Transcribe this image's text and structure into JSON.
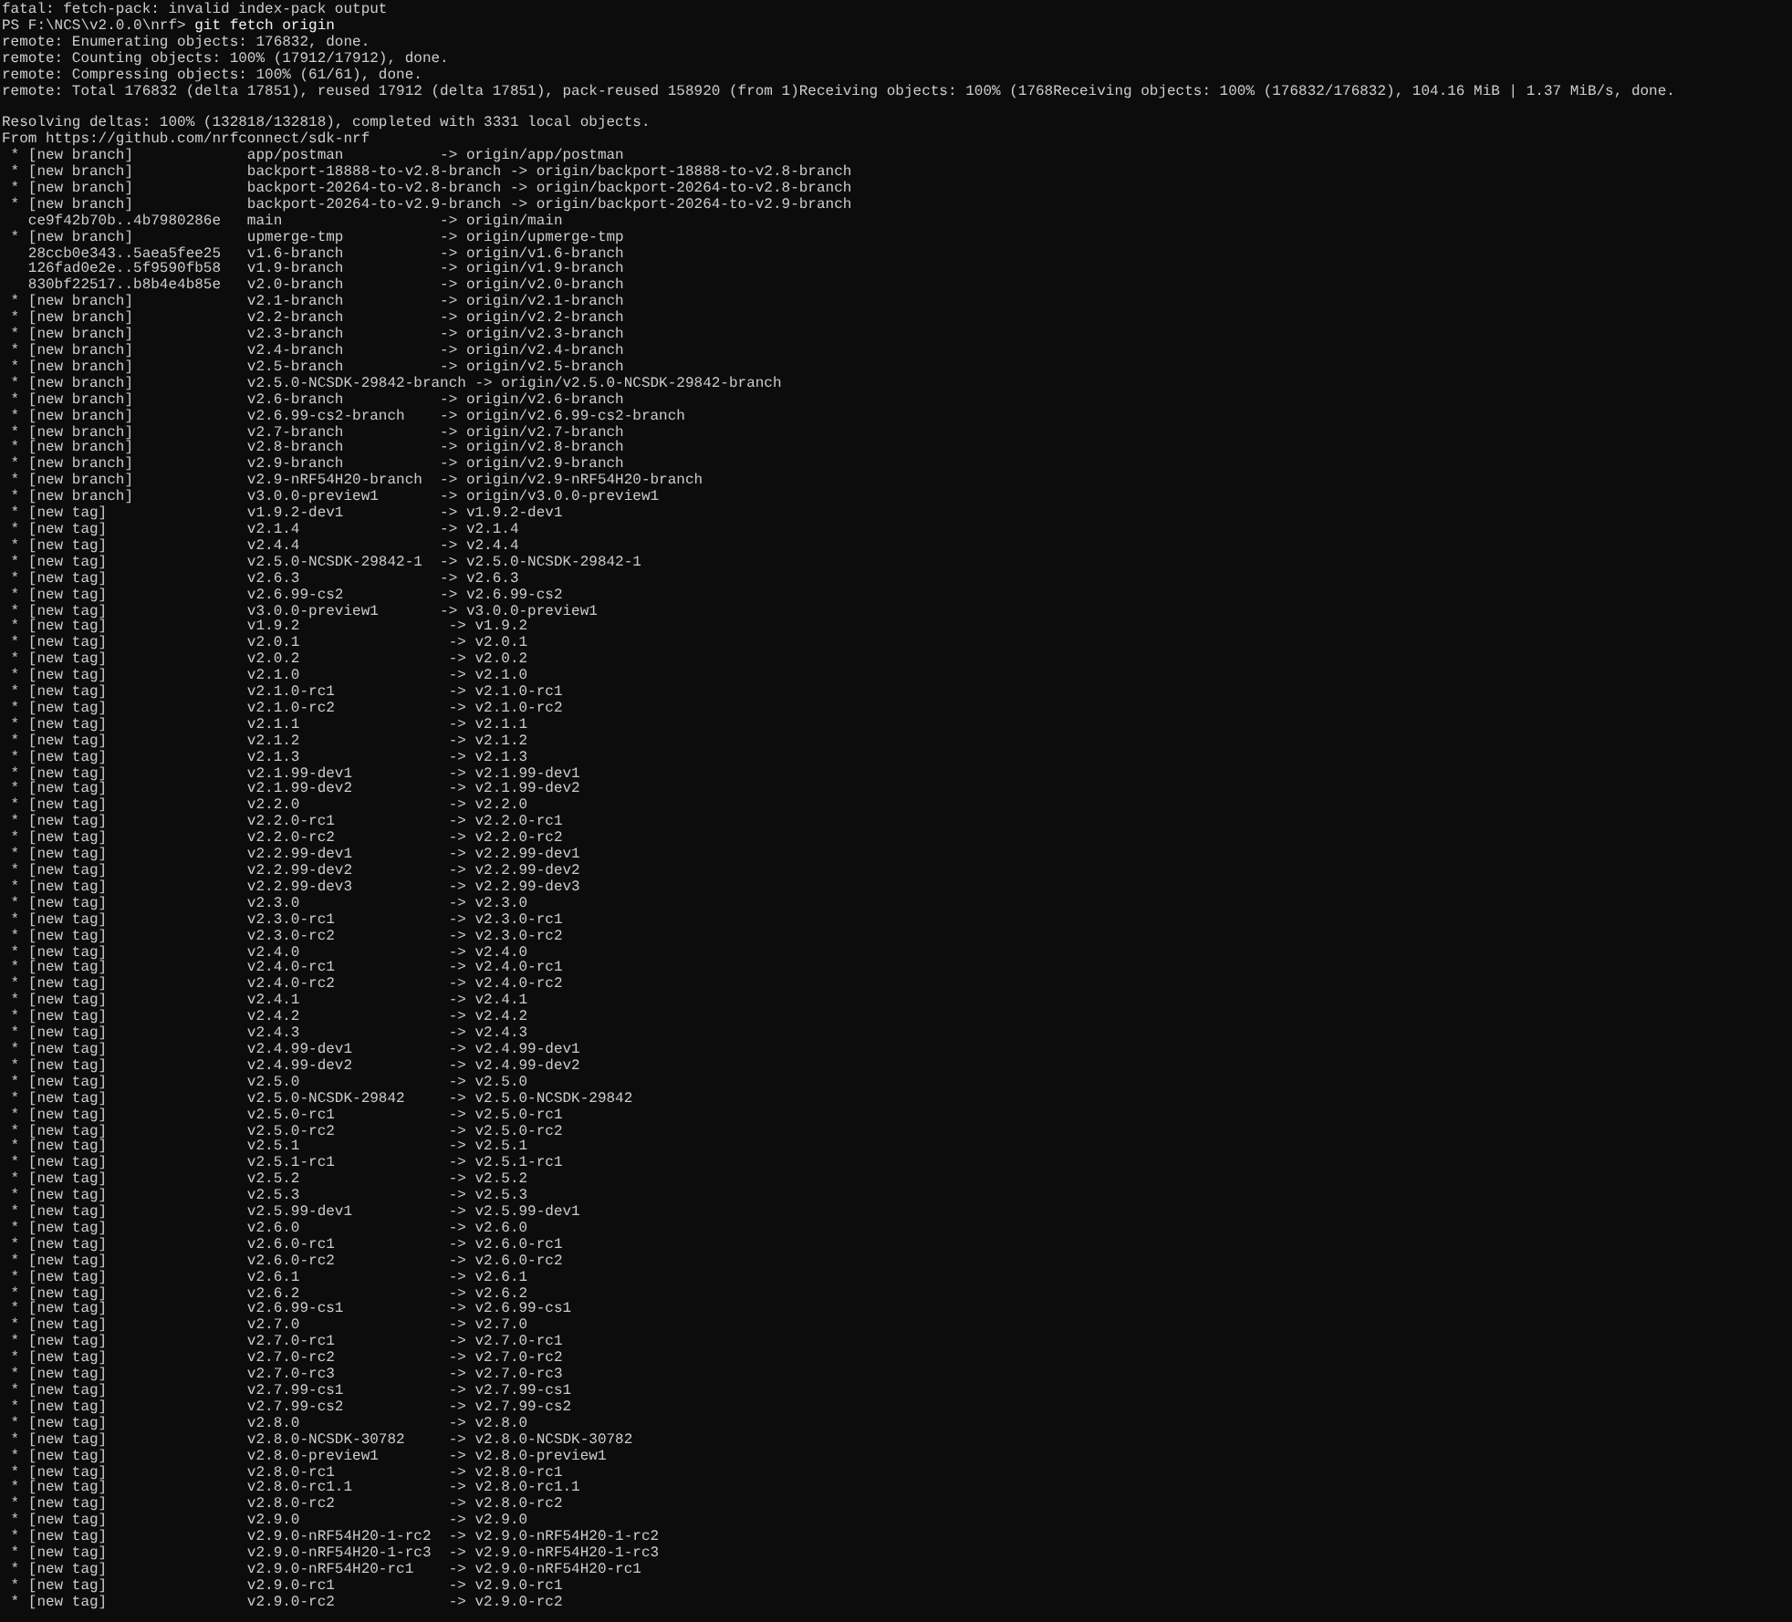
{
  "pre_lines": [
    "fatal: fetch-pack: invalid index-pack output"
  ],
  "prompt": {
    "path": "PS F:\\NCS\\v2.0.0\\nrf>",
    "command": "git fetch origin"
  },
  "output_blocks": [
    [
      "remote: Enumerating objects: 176832, done.",
      "remote: Counting objects: 100% (17912/17912), done.",
      "remote: Compressing objects: 100% (61/61), done.",
      "remote: Total 176832 (delta 17851), reused 17912 (delta 17851), pack-reused 158920 (from 1)Receiving objects: 100% (1768Receiving objects: 100% (176832/176832), 104.16 MiB | 1.37 MiB/s, done."
    ],
    [
      "Resolving deltas: 100% (132818/132818), completed with 3331 local objects.",
      "From https://github.com/nrfconnect/sdk-nrf"
    ]
  ],
  "ref_groups": [
    {
      "refs": [
        {
          "flag": "*",
          "summary": "[new branch]",
          "from": "app/postman",
          "arrow": "->",
          "to": "origin/app/postman"
        },
        {
          "flag": "*",
          "summary": "[new branch]",
          "from": "backport-18888-to-v2.8-branch",
          "arrow": "->",
          "to": "origin/backport-18888-to-v2.8-branch"
        },
        {
          "flag": "*",
          "summary": "[new branch]",
          "from": "backport-20264-to-v2.8-branch",
          "arrow": "->",
          "to": "origin/backport-20264-to-v2.8-branch"
        },
        {
          "flag": "*",
          "summary": "[new branch]",
          "from": "backport-20264-to-v2.9-branch",
          "arrow": "->",
          "to": "origin/backport-20264-to-v2.9-branch"
        },
        {
          "summary": "ce9f42b70b..4b7980286e",
          "from": "main",
          "arrow": "->",
          "to": "origin/main"
        },
        {
          "flag": "*",
          "summary": "[new branch]",
          "from": "upmerge-tmp",
          "arrow": "->",
          "to": "origin/upmerge-tmp"
        },
        {
          "summary": "28ccb0e343..5aea5fee25",
          "from": "v1.6-branch",
          "arrow": "->",
          "to": "origin/v1.6-branch"
        },
        {
          "summary": "126fad0e2e..5f9590fb58",
          "from": "v1.9-branch",
          "arrow": "->",
          "to": "origin/v1.9-branch"
        },
        {
          "summary": "830bf22517..b8b4e4b85e",
          "from": "v2.0-branch",
          "arrow": "->",
          "to": "origin/v2.0-branch"
        },
        {
          "flag": "*",
          "summary": "[new branch]",
          "from": "v2.1-branch",
          "arrow": "->",
          "to": "origin/v2.1-branch"
        },
        {
          "flag": "*",
          "summary": "[new branch]",
          "from": "v2.2-branch",
          "arrow": "->",
          "to": "origin/v2.2-branch"
        },
        {
          "flag": "*",
          "summary": "[new branch]",
          "from": "v2.3-branch",
          "arrow": "->",
          "to": "origin/v2.3-branch"
        },
        {
          "flag": "*",
          "summary": "[new branch]",
          "from": "v2.4-branch",
          "arrow": "->",
          "to": "origin/v2.4-branch"
        },
        {
          "flag": "*",
          "summary": "[new branch]",
          "from": "v2.5-branch",
          "arrow": "->",
          "to": "origin/v2.5-branch"
        },
        {
          "flag": "*",
          "summary": "[new branch]",
          "from": "v2.5.0-NCSDK-29842-branch",
          "arrow": "->",
          "to": "origin/v2.5.0-NCSDK-29842-branch"
        },
        {
          "flag": "*",
          "summary": "[new branch]",
          "from": "v2.6-branch",
          "arrow": "->",
          "to": "origin/v2.6-branch"
        },
        {
          "flag": "*",
          "summary": "[new branch]",
          "from": "v2.6.99-cs2-branch",
          "arrow": "->",
          "to": "origin/v2.6.99-cs2-branch"
        },
        {
          "flag": "*",
          "summary": "[new branch]",
          "from": "v2.7-branch",
          "arrow": "->",
          "to": "origin/v2.7-branch"
        },
        {
          "flag": "*",
          "summary": "[new branch]",
          "from": "v2.8-branch",
          "arrow": "->",
          "to": "origin/v2.8-branch"
        },
        {
          "flag": "*",
          "summary": "[new branch]",
          "from": "v2.9-branch",
          "arrow": "->",
          "to": "origin/v2.9-branch"
        },
        {
          "flag": "*",
          "summary": "[new branch]",
          "from": "v2.9-nRF54H20-branch",
          "arrow": "->",
          "to": "origin/v2.9-nRF54H20-branch"
        },
        {
          "flag": "*",
          "summary": "[new branch]",
          "from": "v3.0.0-preview1",
          "arrow": "->",
          "to": "origin/v3.0.0-preview1"
        },
        {
          "flag": "*",
          "summary": "[new tag]",
          "from": "v1.9.2-dev1",
          "arrow": "->",
          "to": "v1.9.2-dev1"
        },
        {
          "flag": "*",
          "summary": "[new tag]",
          "from": "v2.1.4",
          "arrow": "->",
          "to": "v2.1.4"
        },
        {
          "flag": "*",
          "summary": "[new tag]",
          "from": "v2.4.4",
          "arrow": "->",
          "to": "v2.4.4"
        },
        {
          "flag": "*",
          "summary": "[new tag]",
          "from": "v2.5.0-NCSDK-29842-1",
          "arrow": "->",
          "to": "v2.5.0-NCSDK-29842-1"
        },
        {
          "flag": "*",
          "summary": "[new tag]",
          "from": "v2.6.3",
          "arrow": "->",
          "to": "v2.6.3"
        },
        {
          "flag": "*",
          "summary": "[new tag]",
          "from": "v2.6.99-cs2",
          "arrow": "->",
          "to": "v2.6.99-cs2"
        },
        {
          "flag": "*",
          "summary": "[new tag]",
          "from": "v3.0.0-preview1",
          "arrow": "->",
          "to": "v3.0.0-preview1"
        }
      ]
    },
    {
      "refs": [
        {
          "flag": "*",
          "summary": "[new tag]",
          "from": "v1.9.2",
          "arrow": "->",
          "to": "v1.9.2"
        },
        {
          "flag": "*",
          "summary": "[new tag]",
          "from": "v2.0.1",
          "arrow": "->",
          "to": "v2.0.1"
        },
        {
          "flag": "*",
          "summary": "[new tag]",
          "from": "v2.0.2",
          "arrow": "->",
          "to": "v2.0.2"
        },
        {
          "flag": "*",
          "summary": "[new tag]",
          "from": "v2.1.0",
          "arrow": "->",
          "to": "v2.1.0"
        },
        {
          "flag": "*",
          "summary": "[new tag]",
          "from": "v2.1.0-rc1",
          "arrow": "->",
          "to": "v2.1.0-rc1"
        },
        {
          "flag": "*",
          "summary": "[new tag]",
          "from": "v2.1.0-rc2",
          "arrow": "->",
          "to": "v2.1.0-rc2"
        },
        {
          "flag": "*",
          "summary": "[new tag]",
          "from": "v2.1.1",
          "arrow": "->",
          "to": "v2.1.1"
        },
        {
          "flag": "*",
          "summary": "[new tag]",
          "from": "v2.1.2",
          "arrow": "->",
          "to": "v2.1.2"
        },
        {
          "flag": "*",
          "summary": "[new tag]",
          "from": "v2.1.3",
          "arrow": "->",
          "to": "v2.1.3"
        },
        {
          "flag": "*",
          "summary": "[new tag]",
          "from": "v2.1.99-dev1",
          "arrow": "->",
          "to": "v2.1.99-dev1"
        },
        {
          "flag": "*",
          "summary": "[new tag]",
          "from": "v2.1.99-dev2",
          "arrow": "->",
          "to": "v2.1.99-dev2"
        },
        {
          "flag": "*",
          "summary": "[new tag]",
          "from": "v2.2.0",
          "arrow": "->",
          "to": "v2.2.0"
        },
        {
          "flag": "*",
          "summary": "[new tag]",
          "from": "v2.2.0-rc1",
          "arrow": "->",
          "to": "v2.2.0-rc1"
        },
        {
          "flag": "*",
          "summary": "[new tag]",
          "from": "v2.2.0-rc2",
          "arrow": "->",
          "to": "v2.2.0-rc2"
        },
        {
          "flag": "*",
          "summary": "[new tag]",
          "from": "v2.2.99-dev1",
          "arrow": "->",
          "to": "v2.2.99-dev1"
        },
        {
          "flag": "*",
          "summary": "[new tag]",
          "from": "v2.2.99-dev2",
          "arrow": "->",
          "to": "v2.2.99-dev2"
        },
        {
          "flag": "*",
          "summary": "[new tag]",
          "from": "v2.2.99-dev3",
          "arrow": "->",
          "to": "v2.2.99-dev3"
        },
        {
          "flag": "*",
          "summary": "[new tag]",
          "from": "v2.3.0",
          "arrow": "->",
          "to": "v2.3.0"
        },
        {
          "flag": "*",
          "summary": "[new tag]",
          "from": "v2.3.0-rc1",
          "arrow": "->",
          "to": "v2.3.0-rc1"
        },
        {
          "flag": "*",
          "summary": "[new tag]",
          "from": "v2.3.0-rc2",
          "arrow": "->",
          "to": "v2.3.0-rc2"
        },
        {
          "flag": "*",
          "summary": "[new tag]",
          "from": "v2.4.0",
          "arrow": "->",
          "to": "v2.4.0"
        },
        {
          "flag": "*",
          "summary": "[new tag]",
          "from": "v2.4.0-rc1",
          "arrow": "->",
          "to": "v2.4.0-rc1"
        },
        {
          "flag": "*",
          "summary": "[new tag]",
          "from": "v2.4.0-rc2",
          "arrow": "->",
          "to": "v2.4.0-rc2"
        },
        {
          "flag": "*",
          "summary": "[new tag]",
          "from": "v2.4.1",
          "arrow": "->",
          "to": "v2.4.1"
        },
        {
          "flag": "*",
          "summary": "[new tag]",
          "from": "v2.4.2",
          "arrow": "->",
          "to": "v2.4.2"
        },
        {
          "flag": "*",
          "summary": "[new tag]",
          "from": "v2.4.3",
          "arrow": "->",
          "to": "v2.4.3"
        },
        {
          "flag": "*",
          "summary": "[new tag]",
          "from": "v2.4.99-dev1",
          "arrow": "->",
          "to": "v2.4.99-dev1"
        },
        {
          "flag": "*",
          "summary": "[new tag]",
          "from": "v2.4.99-dev2",
          "arrow": "->",
          "to": "v2.4.99-dev2"
        },
        {
          "flag": "*",
          "summary": "[new tag]",
          "from": "v2.5.0",
          "arrow": "->",
          "to": "v2.5.0"
        },
        {
          "flag": "*",
          "summary": "[new tag]",
          "from": "v2.5.0-NCSDK-29842",
          "arrow": "->",
          "to": "v2.5.0-NCSDK-29842"
        },
        {
          "flag": "*",
          "summary": "[new tag]",
          "from": "v2.5.0-rc1",
          "arrow": "->",
          "to": "v2.5.0-rc1"
        },
        {
          "flag": "*",
          "summary": "[new tag]",
          "from": "v2.5.0-rc2",
          "arrow": "->",
          "to": "v2.5.0-rc2"
        },
        {
          "flag": "*",
          "summary": "[new tag]",
          "from": "v2.5.1",
          "arrow": "->",
          "to": "v2.5.1"
        },
        {
          "flag": "*",
          "summary": "[new tag]",
          "from": "v2.5.1-rc1",
          "arrow": "->",
          "to": "v2.5.1-rc1"
        },
        {
          "flag": "*",
          "summary": "[new tag]",
          "from": "v2.5.2",
          "arrow": "->",
          "to": "v2.5.2"
        },
        {
          "flag": "*",
          "summary": "[new tag]",
          "from": "v2.5.3",
          "arrow": "->",
          "to": "v2.5.3"
        },
        {
          "flag": "*",
          "summary": "[new tag]",
          "from": "v2.5.99-dev1",
          "arrow": "->",
          "to": "v2.5.99-dev1"
        },
        {
          "flag": "*",
          "summary": "[new tag]",
          "from": "v2.6.0",
          "arrow": "->",
          "to": "v2.6.0"
        },
        {
          "flag": "*",
          "summary": "[new tag]",
          "from": "v2.6.0-rc1",
          "arrow": "->",
          "to": "v2.6.0-rc1"
        },
        {
          "flag": "*",
          "summary": "[new tag]",
          "from": "v2.6.0-rc2",
          "arrow": "->",
          "to": "v2.6.0-rc2"
        },
        {
          "flag": "*",
          "summary": "[new tag]",
          "from": "v2.6.1",
          "arrow": "->",
          "to": "v2.6.1"
        },
        {
          "flag": "*",
          "summary": "[new tag]",
          "from": "v2.6.2",
          "arrow": "->",
          "to": "v2.6.2"
        },
        {
          "flag": "*",
          "summary": "[new tag]",
          "from": "v2.6.99-cs1",
          "arrow": "->",
          "to": "v2.6.99-cs1"
        },
        {
          "flag": "*",
          "summary": "[new tag]",
          "from": "v2.7.0",
          "arrow": "->",
          "to": "v2.7.0"
        },
        {
          "flag": "*",
          "summary": "[new tag]",
          "from": "v2.7.0-rc1",
          "arrow": "->",
          "to": "v2.7.0-rc1"
        },
        {
          "flag": "*",
          "summary": "[new tag]",
          "from": "v2.7.0-rc2",
          "arrow": "->",
          "to": "v2.7.0-rc2"
        },
        {
          "flag": "*",
          "summary": "[new tag]",
          "from": "v2.7.0-rc3",
          "arrow": "->",
          "to": "v2.7.0-rc3"
        },
        {
          "flag": "*",
          "summary": "[new tag]",
          "from": "v2.7.99-cs1",
          "arrow": "->",
          "to": "v2.7.99-cs1"
        },
        {
          "flag": "*",
          "summary": "[new tag]",
          "from": "v2.7.99-cs2",
          "arrow": "->",
          "to": "v2.7.99-cs2"
        },
        {
          "flag": "*",
          "summary": "[new tag]",
          "from": "v2.8.0",
          "arrow": "->",
          "to": "v2.8.0"
        },
        {
          "flag": "*",
          "summary": "[new tag]",
          "from": "v2.8.0-NCSDK-30782",
          "arrow": "->",
          "to": "v2.8.0-NCSDK-30782"
        },
        {
          "flag": "*",
          "summary": "[new tag]",
          "from": "v2.8.0-preview1",
          "arrow": "->",
          "to": "v2.8.0-preview1"
        },
        {
          "flag": "*",
          "summary": "[new tag]",
          "from": "v2.8.0-rc1",
          "arrow": "->",
          "to": "v2.8.0-rc1"
        },
        {
          "flag": "*",
          "summary": "[new tag]",
          "from": "v2.8.0-rc1.1",
          "arrow": "->",
          "to": "v2.8.0-rc1.1"
        },
        {
          "flag": "*",
          "summary": "[new tag]",
          "from": "v2.8.0-rc2",
          "arrow": "->",
          "to": "v2.8.0-rc2"
        },
        {
          "flag": "*",
          "summary": "[new tag]",
          "from": "v2.9.0",
          "arrow": "->",
          "to": "v2.9.0"
        },
        {
          "flag": "*",
          "summary": "[new tag]",
          "from": "v2.9.0-nRF54H20-1-rc2",
          "arrow": "->",
          "to": "v2.9.0-nRF54H20-1-rc2"
        },
        {
          "flag": "*",
          "summary": "[new tag]",
          "from": "v2.9.0-nRF54H20-1-rc3",
          "arrow": "->",
          "to": "v2.9.0-nRF54H20-1-rc3"
        },
        {
          "flag": "*",
          "summary": "[new tag]",
          "from": "v2.9.0-nRF54H20-rc1",
          "arrow": "->",
          "to": "v2.9.0-nRF54H20-rc1"
        },
        {
          "flag": "*",
          "summary": "[new tag]",
          "from": "v2.9.0-rc1",
          "arrow": "->",
          "to": "v2.9.0-rc1"
        },
        {
          "flag": "*",
          "summary": "[new tag]",
          "from": "v2.9.0-rc2",
          "arrow": "->",
          "to": "v2.9.0-rc2"
        }
      ]
    }
  ]
}
